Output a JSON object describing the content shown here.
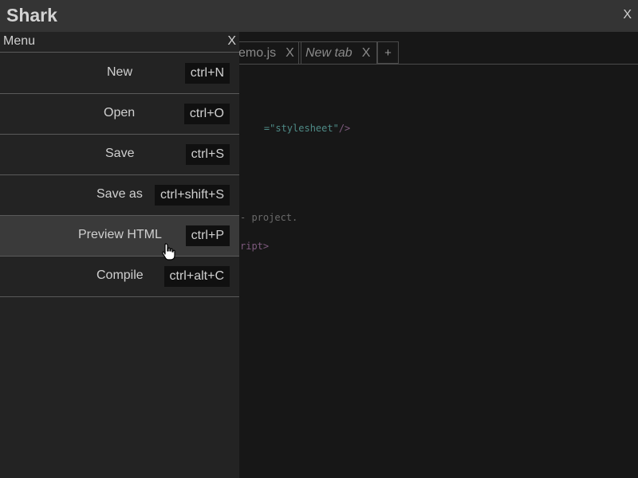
{
  "app": {
    "title": "Shark",
    "close_label": "X"
  },
  "tabs": [
    {
      "label": "emo.js",
      "close": "X",
      "italic": false
    },
    {
      "label": "New tab",
      "close": "X",
      "italic": true
    }
  ],
  "tab_add_label": "+",
  "code": [
    {
      "text": "=\"stylesheet\"",
      "suffix": "/>",
      "tone": "string"
    },
    {
      "text": "- project.",
      "tone": "comment"
    },
    {
      "text": "ript>",
      "tone": "tag"
    }
  ],
  "menu": {
    "title": "Menu",
    "close_label": "X",
    "items": [
      {
        "label": "New",
        "shortcut": "ctrl+N"
      },
      {
        "label": "Open",
        "shortcut": "ctrl+O"
      },
      {
        "label": "Save",
        "shortcut": "ctrl+S"
      },
      {
        "label": "Save as",
        "shortcut": "ctrl+shift+S"
      },
      {
        "label": "Preview HTML",
        "shortcut": "ctrl+P",
        "hovered": true
      },
      {
        "label": "Compile",
        "shortcut": "ctrl+alt+C"
      }
    ]
  },
  "colors": {
    "titlebar": "#343434",
    "background": "#171717",
    "menu_background": "#232323",
    "menu_hover": "#3a3a3a",
    "shortcut_background": "#101010",
    "text": "#d0d0d0"
  },
  "icons": {
    "cursor": "hand-pointer-icon"
  }
}
